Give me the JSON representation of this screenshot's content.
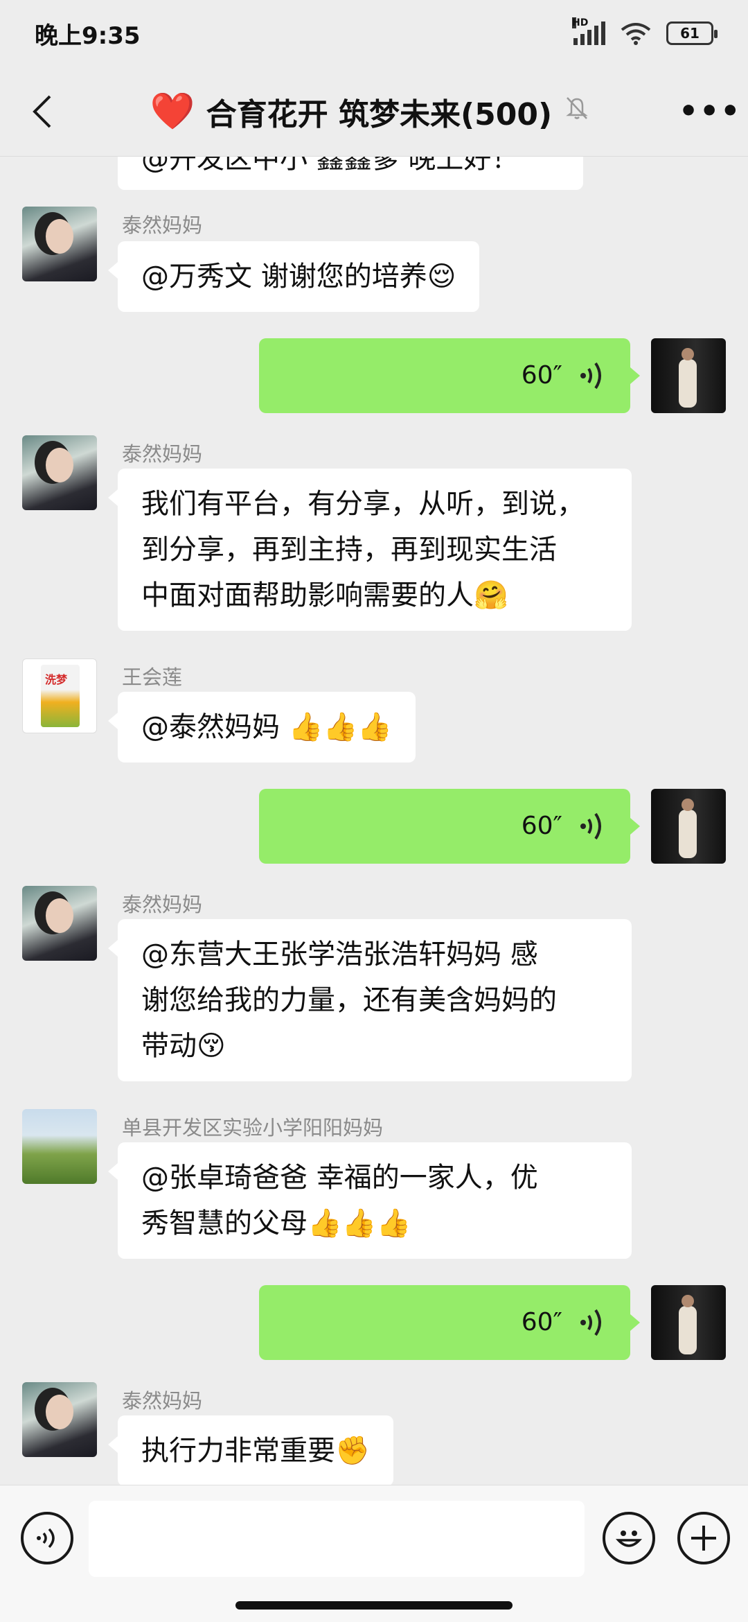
{
  "status_bar": {
    "time": "晚上9:35",
    "network": "HD",
    "battery": "61"
  },
  "header": {
    "title": "合育花开 筑梦未来(500)",
    "title_emoji": "❤️"
  },
  "messages": [
    {
      "partial_text": "@开发区中小 鑫鑫爹 晚上好！"
    },
    {
      "sender": "泰然妈妈",
      "text": "@万秀文  谢谢您的培养😌"
    },
    {
      "sender": "self",
      "duration": "60″"
    },
    {
      "sender": "泰然妈妈",
      "lines": [
        "我们有平台，有分享，从听，到说，",
        "到分享，再到主持，再到现实生活",
        "中面对面帮助影响需要的人🤗"
      ]
    },
    {
      "sender": "王会莲",
      "text": "@泰然妈妈  👍👍👍"
    },
    {
      "sender": "self",
      "duration": "60″"
    },
    {
      "sender": "泰然妈妈",
      "lines": [
        "@东营大王张学浩张浩轩妈妈  感",
        "谢您给我的力量，还有美含妈妈的",
        "带动😚"
      ]
    },
    {
      "sender": "单县开发区实验小学阳阳妈妈",
      "lines": [
        "@张卓琦爸爸  幸福的一家人，优",
        "秀智慧的父母👍👍👍"
      ]
    },
    {
      "sender": "self",
      "duration": "60″"
    },
    {
      "sender": "泰然妈妈",
      "text": "执行力非常重要✊"
    }
  ],
  "input_bar": {
    "placeholder": ""
  },
  "colors": {
    "background": "#ededed",
    "self_bubble": "#95ec69",
    "other_bubble": "#ffffff"
  }
}
